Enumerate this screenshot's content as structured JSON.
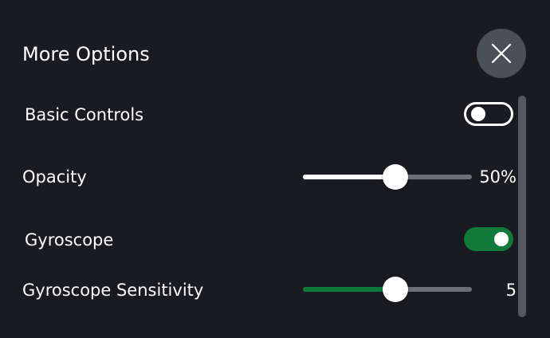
{
  "panel": {
    "title": "More Options",
    "close_icon": "close-icon"
  },
  "settings": {
    "basic_controls": {
      "label": "Basic Controls",
      "enabled": false
    },
    "opacity": {
      "label": "Opacity",
      "value": 50,
      "min": 0,
      "max": 100,
      "display": "50%",
      "fill_color": "#ffffff"
    },
    "gyroscope": {
      "label": "Gyroscope",
      "enabled": true
    },
    "gyro_sensitivity": {
      "label": "Gyroscope Sensitivity",
      "value": 5,
      "min": 0,
      "max": 10,
      "display": "5",
      "fill_color": "#0f7a3a"
    }
  },
  "colors": {
    "background": "#1a1b20",
    "accent_green": "#0f7a3a",
    "close_button_bg": "#4b4f57"
  }
}
